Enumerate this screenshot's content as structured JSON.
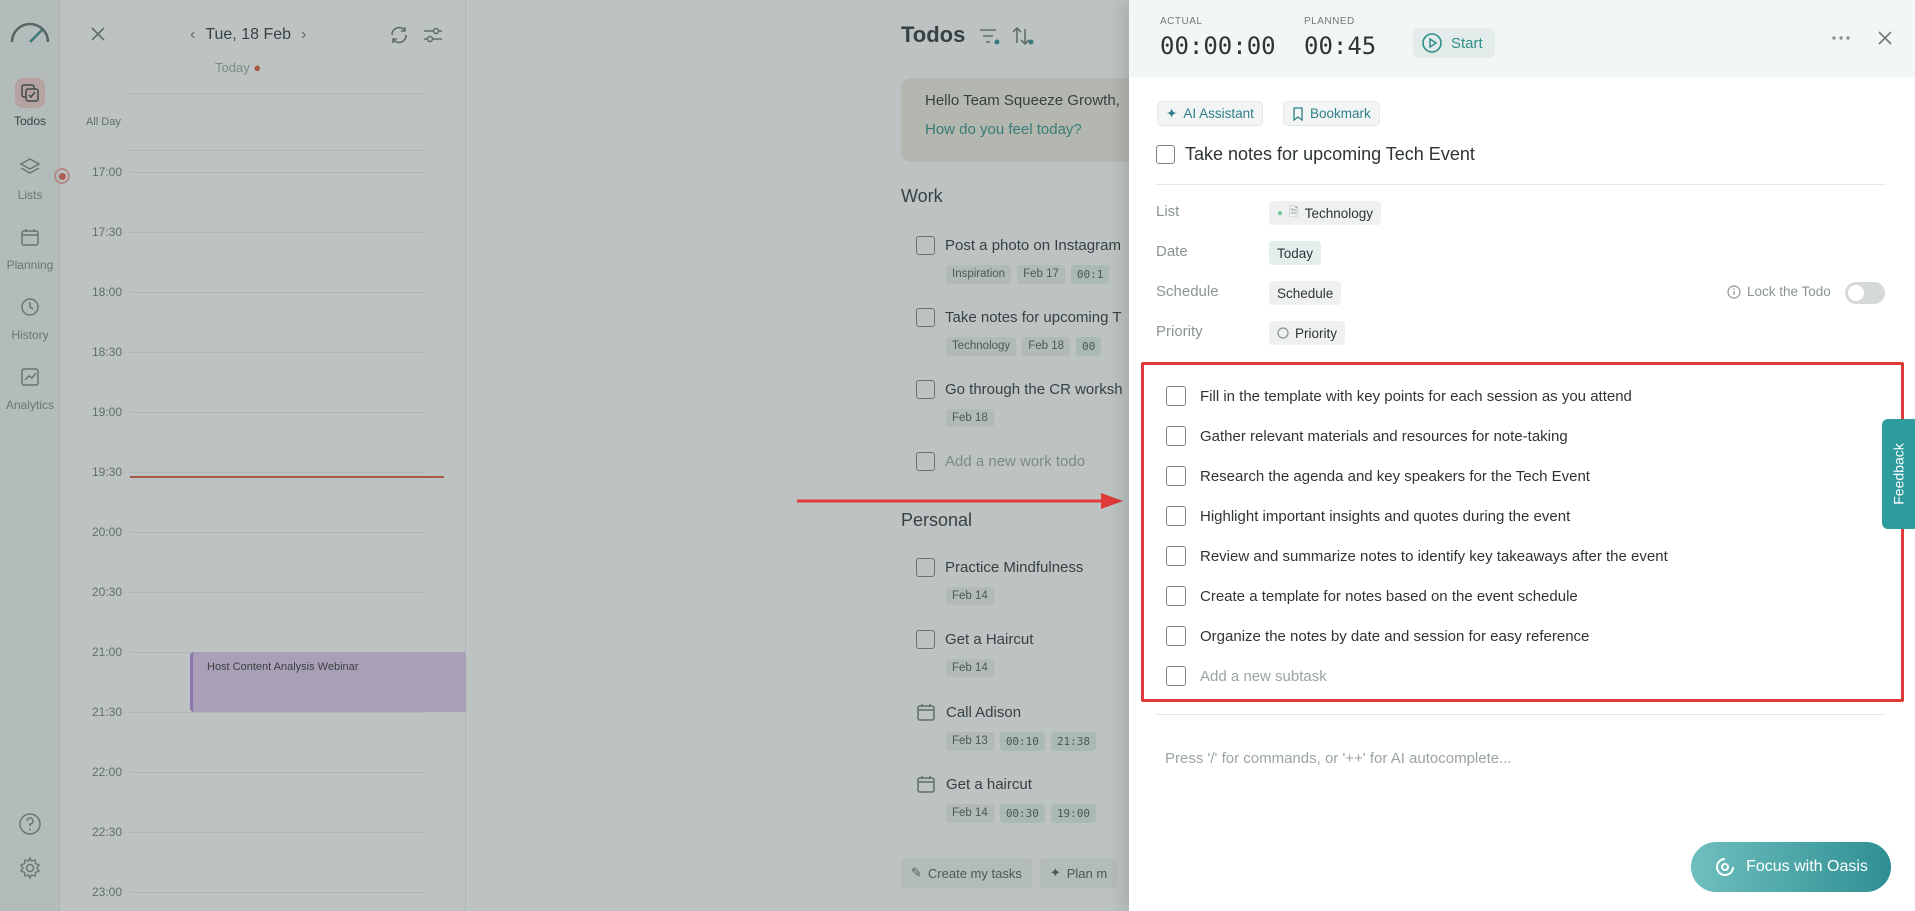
{
  "sidebar": {
    "items": [
      {
        "label": "Todos",
        "icon": "todos-icon"
      },
      {
        "label": "Lists",
        "icon": "layers-icon"
      },
      {
        "label": "Planning",
        "icon": "calendar-icon"
      },
      {
        "label": "History",
        "icon": "clock-icon"
      },
      {
        "label": "Analytics",
        "icon": "chart-icon"
      }
    ],
    "active": "Todos"
  },
  "calendar": {
    "date": "Tue, 18 Feb",
    "today_label": "Today",
    "all_day": "All Day",
    "times": [
      "17:00",
      "17:30",
      "18:00",
      "18:30",
      "19:00",
      "19:30",
      "20:00",
      "20:30",
      "21:00",
      "21:30",
      "22:00",
      "22:30",
      "23:00"
    ],
    "event": "Host Content Analysis Webinar"
  },
  "todos": {
    "title": "Todos",
    "greeting": "Hello Team Squeeze Growth,",
    "mood_prompt": "How do you feel today?",
    "work_section": "Work",
    "work_items": [
      {
        "title": "Post a photo on Instagram",
        "chips": [
          "Inspiration",
          "Feb 17",
          "00:1"
        ]
      },
      {
        "title": "Take notes for upcoming T",
        "chips": [
          "Technology",
          "Feb 18",
          "00"
        ]
      },
      {
        "title": "Go through the CR worksh",
        "chips": [
          "Feb 18"
        ]
      }
    ],
    "add_work": "Add a new work todo",
    "personal_section": "Personal",
    "personal_items": [
      {
        "title": "Practice Mindfulness",
        "chips": [
          "Feb 14"
        ]
      },
      {
        "title": "Get a Haircut",
        "chips": [
          "Feb 14"
        ]
      },
      {
        "title": "Call Adison",
        "chips": [
          "Feb 13",
          "00:10",
          "21:38"
        ]
      },
      {
        "title": "Get a haircut",
        "chips": [
          "Feb 14",
          "00:30",
          "19:00"
        ]
      }
    ],
    "footer": {
      "create": "Create my tasks",
      "plan": "Plan m"
    }
  },
  "panel": {
    "actual_label": "ACTUAL",
    "actual_value": "00:00:00",
    "planned_label": "PLANNED",
    "planned_value": "00:45",
    "start": "Start",
    "ai_assistant": "AI Assistant",
    "bookmark": "Bookmark",
    "task_title": "Take notes for upcoming Tech Event",
    "props": {
      "list_label": "List",
      "list_value": "Technology",
      "date_label": "Date",
      "date_value": "Today",
      "schedule_label": "Schedule",
      "schedule_value": "Schedule",
      "priority_label": "Priority",
      "priority_value": "Priority",
      "lock": "Lock the Todo"
    },
    "subtasks": [
      "Fill in the template with key points for each session as you attend",
      "Gather relevant materials and resources for note-taking",
      "Research the agenda and key speakers for the Tech Event",
      "Highlight important insights and quotes during the event",
      "Review and summarize notes to identify key takeaways after the event",
      "Create a template for notes based on the event schedule",
      "Organize the notes by date and session for easy reference"
    ],
    "add_subtask": "Add a new subtask",
    "editor_placeholder": "Press '/' for commands, or '++' for AI autocomplete...",
    "focus_button": "Focus with Oasis"
  },
  "feedback": "Feedback",
  "colors": {
    "accent": "#2e8f93",
    "annotation": "#e03a3a",
    "now_line": "#e25b3a",
    "event": "#e1c8ef"
  }
}
